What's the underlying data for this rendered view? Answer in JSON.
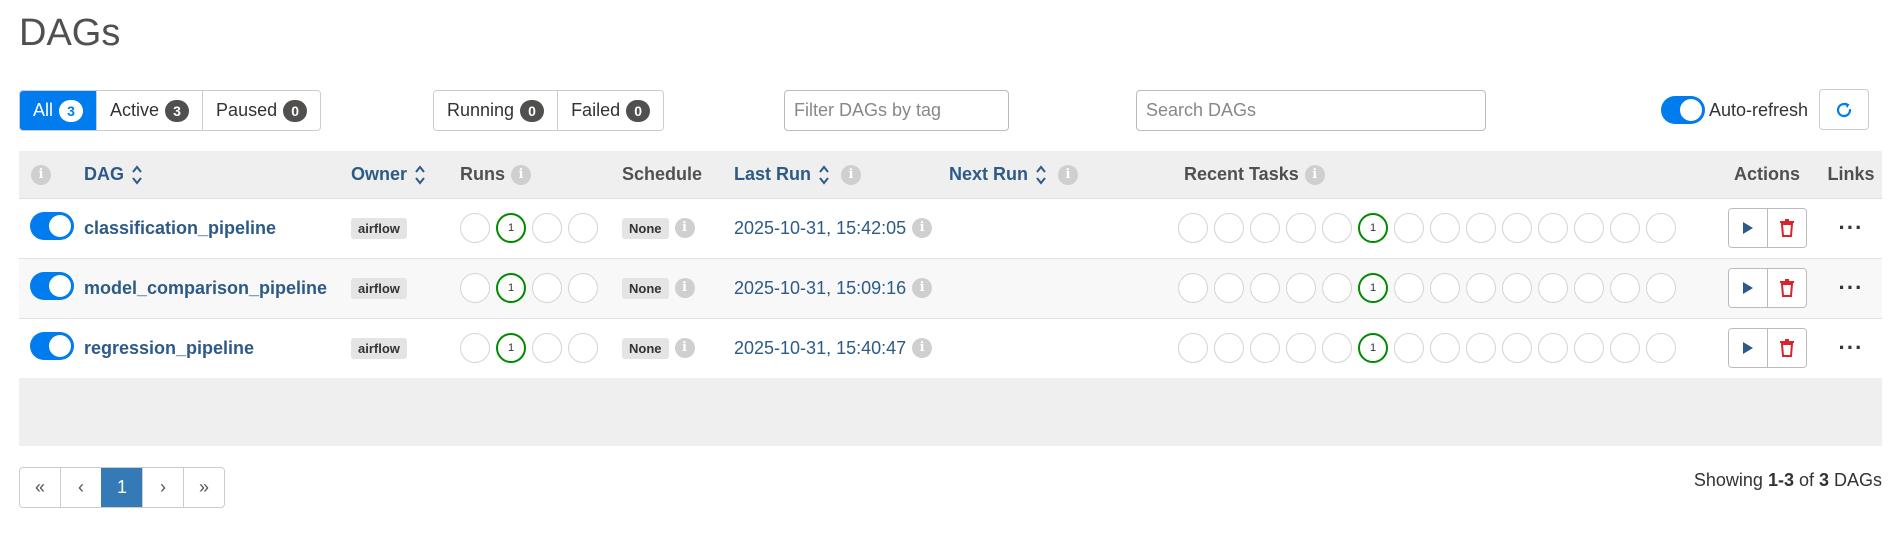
{
  "page_title": "DAGs",
  "status_filters": [
    {
      "label": "All",
      "count": "3",
      "active": true
    },
    {
      "label": "Active",
      "count": "3",
      "active": false
    },
    {
      "label": "Paused",
      "count": "0",
      "active": false
    }
  ],
  "run_filters": [
    {
      "label": "Running",
      "count": "0"
    },
    {
      "label": "Failed",
      "count": "0"
    }
  ],
  "tag_filter": {
    "placeholder": "Filter DAGs by tag"
  },
  "search": {
    "placeholder": "Search DAGs"
  },
  "auto_refresh": {
    "label": "Auto-refresh",
    "enabled": true
  },
  "table": {
    "headers": {
      "dag": "DAG",
      "owner": "Owner",
      "runs": "Runs",
      "schedule": "Schedule",
      "last_run": "Last Run",
      "next_run": "Next Run",
      "recent_tasks": "Recent Tasks",
      "actions": "Actions",
      "links": "Links"
    },
    "rows": [
      {
        "name": "classification_pipeline",
        "owner": "airflow",
        "runs_success": "1",
        "schedule": "None",
        "last_run": "2025-10-31, 15:42:05",
        "next_run": "",
        "recent_success": "1"
      },
      {
        "name": "model_comparison_pipeline",
        "owner": "airflow",
        "runs_success": "1",
        "schedule": "None",
        "last_run": "2025-10-31, 15:09:16",
        "next_run": "",
        "recent_success": "1"
      },
      {
        "name": "regression_pipeline",
        "owner": "airflow",
        "runs_success": "1",
        "schedule": "None",
        "last_run": "2025-10-31, 15:40:47",
        "next_run": "",
        "recent_success": "1"
      }
    ]
  },
  "pagination": {
    "first": "«",
    "prev": "‹",
    "current": "1",
    "next": "›",
    "last": "»"
  },
  "showing": {
    "prefix": "Showing ",
    "range": "1-3",
    "middle": " of ",
    "total": "3",
    "suffix": " DAGs"
  },
  "icons": {
    "info": "info-icon",
    "sort": "sort-icon",
    "refresh": "refresh-icon",
    "play": "play-icon",
    "delete": "trash-icon",
    "more": "ellipsis-icon"
  },
  "colors": {
    "primary": "#017cee",
    "link": "#2d5a86",
    "success": "#018a00",
    "danger": "#d9232d"
  }
}
